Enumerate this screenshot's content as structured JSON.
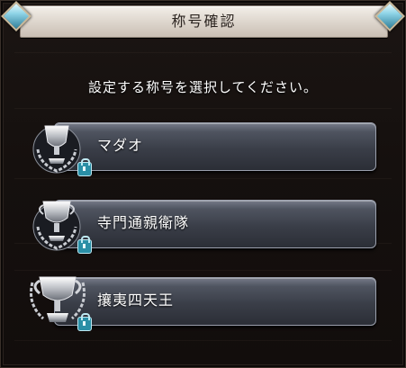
{
  "dialog": {
    "title": "称号確認",
    "prompt": "設定する称号を選択してください。"
  },
  "titles": [
    {
      "label": "マダオ",
      "locked": true,
      "icon": "silver-trophy-icon"
    },
    {
      "label": "寺門通親衛隊",
      "locked": true,
      "icon": "silver-trophy-icon"
    },
    {
      "label": "攘夷四天王",
      "locked": true,
      "icon": "silver-trophy-icon"
    }
  ],
  "colors": {
    "header_bg": "#e7e1d9",
    "button_bg": "#3a3e48",
    "gem": "#8ed3e6",
    "lock": "#2a8fa6"
  }
}
